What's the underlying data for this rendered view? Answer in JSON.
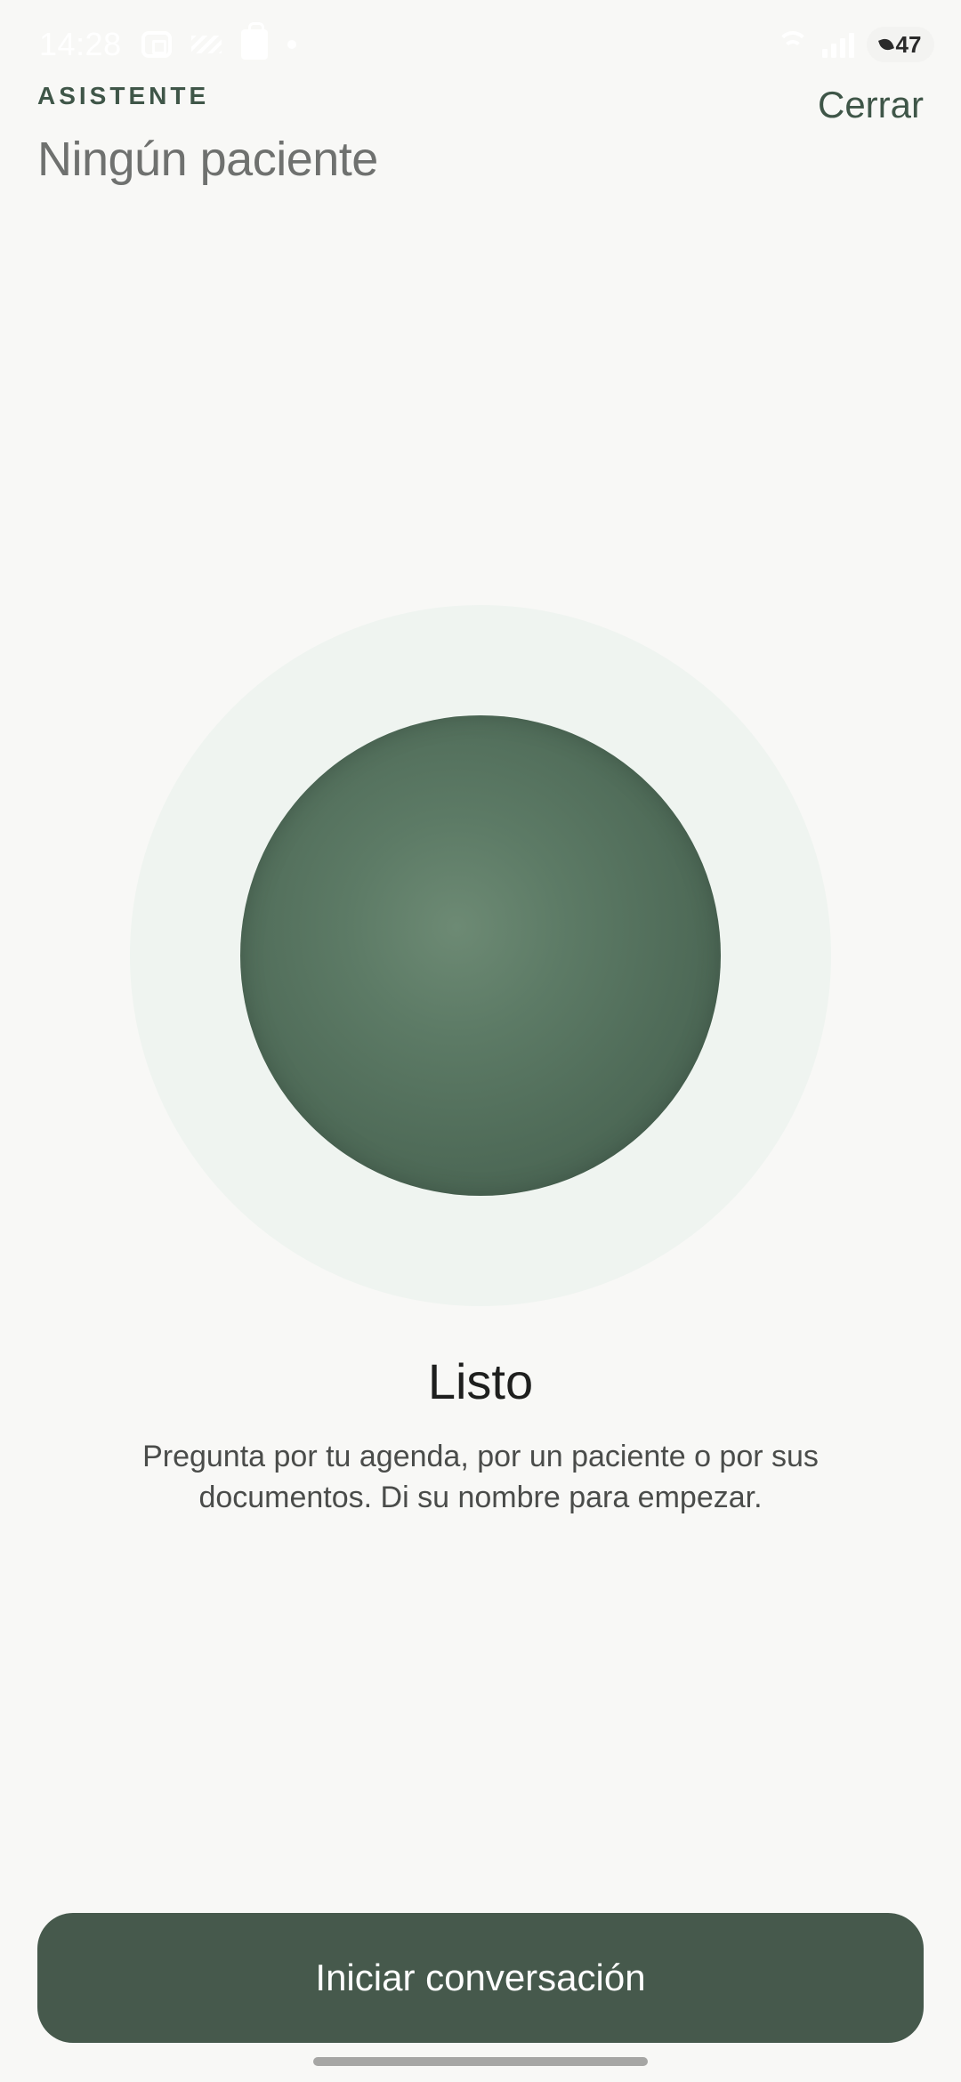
{
  "status_bar": {
    "time": "14:28",
    "battery_level": "47",
    "icons": [
      "screen-record-icon",
      "stripes-icon",
      "shopping-bag-icon",
      "dot-icon",
      "wifi-icon",
      "signal-icon",
      "battery-icon"
    ]
  },
  "header": {
    "eyebrow": "ASISTENTE",
    "title": "Ningún paciente",
    "close_label": "Cerrar"
  },
  "assistant": {
    "state_title": "Listo",
    "state_description": "Pregunta por tu agenda, por un paciente o por sus documentos. Di su nombre para empezar."
  },
  "footer": {
    "start_label": "Iniciar conversación"
  },
  "colors": {
    "background": "#f8f8f6",
    "accent": "#46594c",
    "eyebrow": "#3f5648",
    "halo": "#eff4f0",
    "orb_center": "#6d8a74",
    "orb_edge": "#425a4b"
  }
}
